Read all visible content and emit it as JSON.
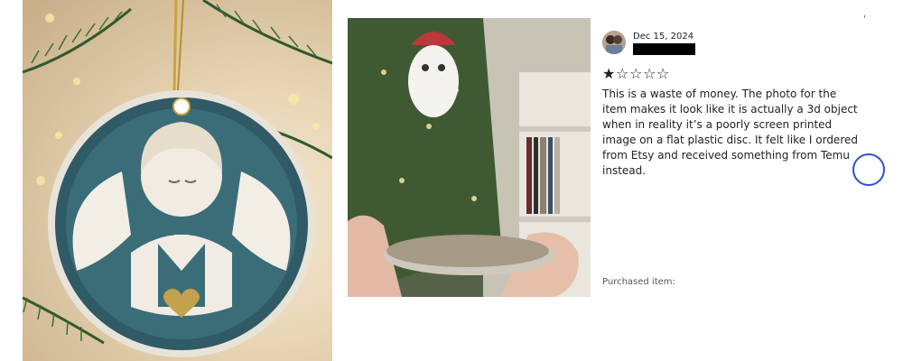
{
  "review": {
    "date": "Dec 15, 2024",
    "rating": 1,
    "max_rating": 5,
    "stars": [
      "★",
      "☆",
      "☆",
      "☆",
      "☆"
    ],
    "text": "This is a waste of money. The photo for the item makes it look like it is actually a 3d object when in reality it’s a poorly screen printed image on a flat plastic disc. It felt like I ordered from Etsy and received something from Temu instead.",
    "purchased_label": "Purchased item:"
  },
  "icons": {
    "avatar": "reviewer-avatar",
    "filled_star": "star-filled-icon",
    "empty_star": "star-empty-icon",
    "scroll": "carousel-next-button"
  },
  "colors": {
    "accent_ring": "#2b4fd8",
    "redaction": "#000000"
  }
}
